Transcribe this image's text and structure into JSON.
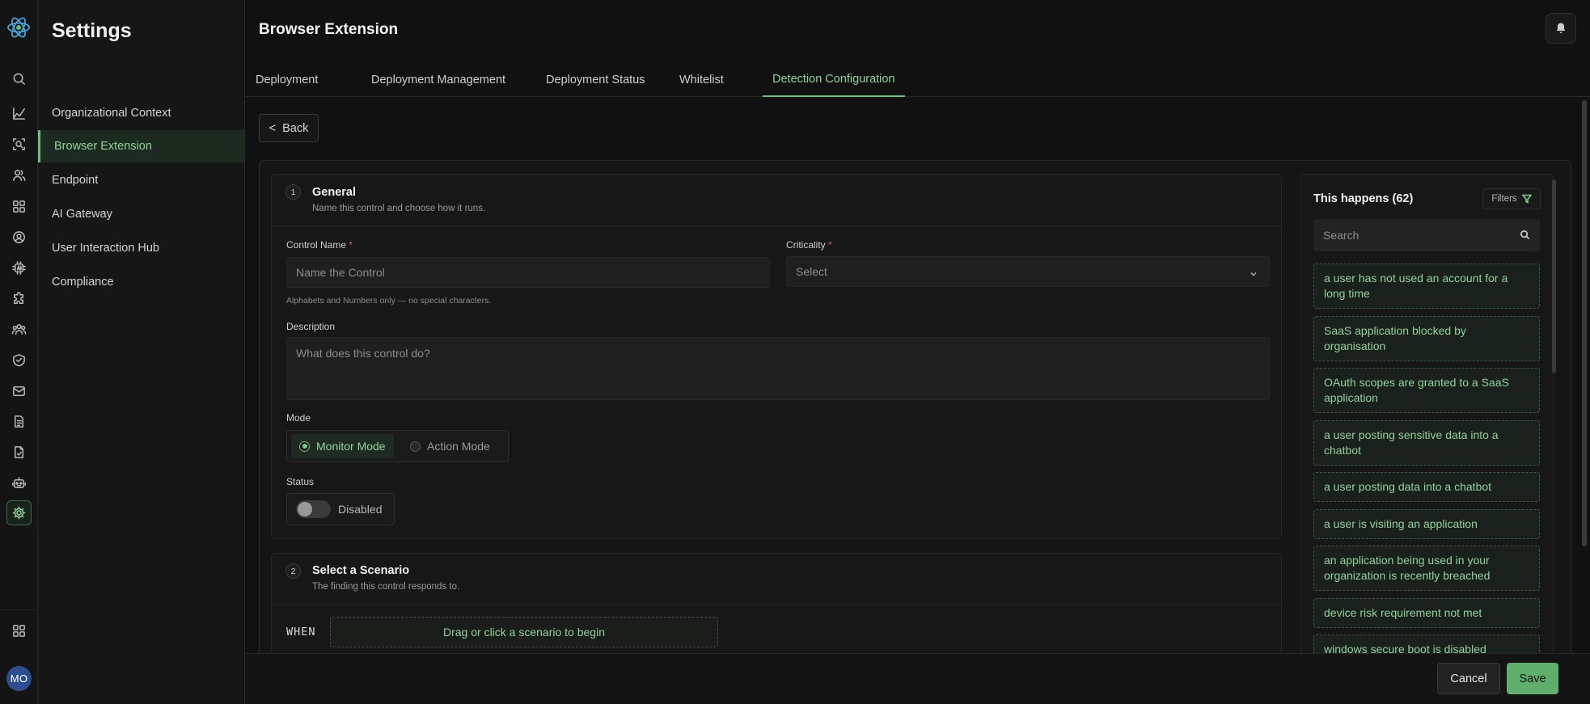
{
  "app": {
    "sidebar_title": "Settings",
    "page_title": "Browser Extension",
    "user_initials": "MO"
  },
  "rail_icons": [
    "search-icon",
    "chart-icon",
    "scan-icon",
    "users-icon",
    "apps-icon",
    "user-circle-icon",
    "ai-icon",
    "extension-icon",
    "team-icon",
    "shield-check-icon",
    "mail-icon",
    "report-icon",
    "document-icon",
    "robot-icon",
    "gear-icon",
    "grid-icon"
  ],
  "sidebar": {
    "items": [
      {
        "label": "Organizational Context"
      },
      {
        "label": "Browser Extension",
        "active": true
      },
      {
        "label": "Endpoint"
      },
      {
        "label": "AI Gateway"
      },
      {
        "label": "User Interaction Hub"
      },
      {
        "label": "Compliance"
      }
    ]
  },
  "tabs": [
    {
      "label": "Deployment"
    },
    {
      "label": "Deployment Management"
    },
    {
      "label": "Deployment Status"
    },
    {
      "label": "Whitelist"
    },
    {
      "label": "Detection Configuration",
      "active": true
    }
  ],
  "back_label": "Back",
  "general": {
    "num": "1",
    "title": "General",
    "subtitle": "Name this control and choose how it runs.",
    "control_name_label": "Control Name",
    "required_mark": "*",
    "control_name_placeholder": "Name the Control",
    "control_name_hint": "Alphabets and Numbers only — no special characters.",
    "criticality_label": "Criticality",
    "criticality_value": "Select",
    "description_label": "Description",
    "description_placeholder": "What does this control do?",
    "mode_label": "Mode",
    "mode_options": [
      {
        "label": "Monitor Mode",
        "selected": true
      },
      {
        "label": "Action Mode",
        "selected": false
      }
    ],
    "status_label": "Status",
    "status_value": "Disabled"
  },
  "scenario": {
    "num": "2",
    "title": "Select a Scenario",
    "subtitle": "The finding this control responds to.",
    "when_label": "WHEN",
    "dropzone_text": "Drag or click a scenario to begin"
  },
  "happens": {
    "title": "This happens (62)",
    "filters_label": "Filters",
    "search_placeholder": "Search",
    "items": [
      "a user has not used an account for a long time",
      "SaaS application blocked by organisation",
      "OAuth scopes are granted to a SaaS application",
      "a user posting sensitive data into a chatbot",
      "a user posting data into a chatbot",
      "a user is visiting an application",
      "an application being used in your organization is recently breached",
      "device risk requirement not met",
      "windows secure boot is disabled"
    ]
  },
  "footer": {
    "cancel_label": "Cancel",
    "save_label": "Save"
  },
  "colors": {
    "accent": "#6fbf7d",
    "accent_text": "#8fd39a",
    "background": "#111111",
    "required": "#e05a5a",
    "avatar": "#2d4f8f"
  }
}
